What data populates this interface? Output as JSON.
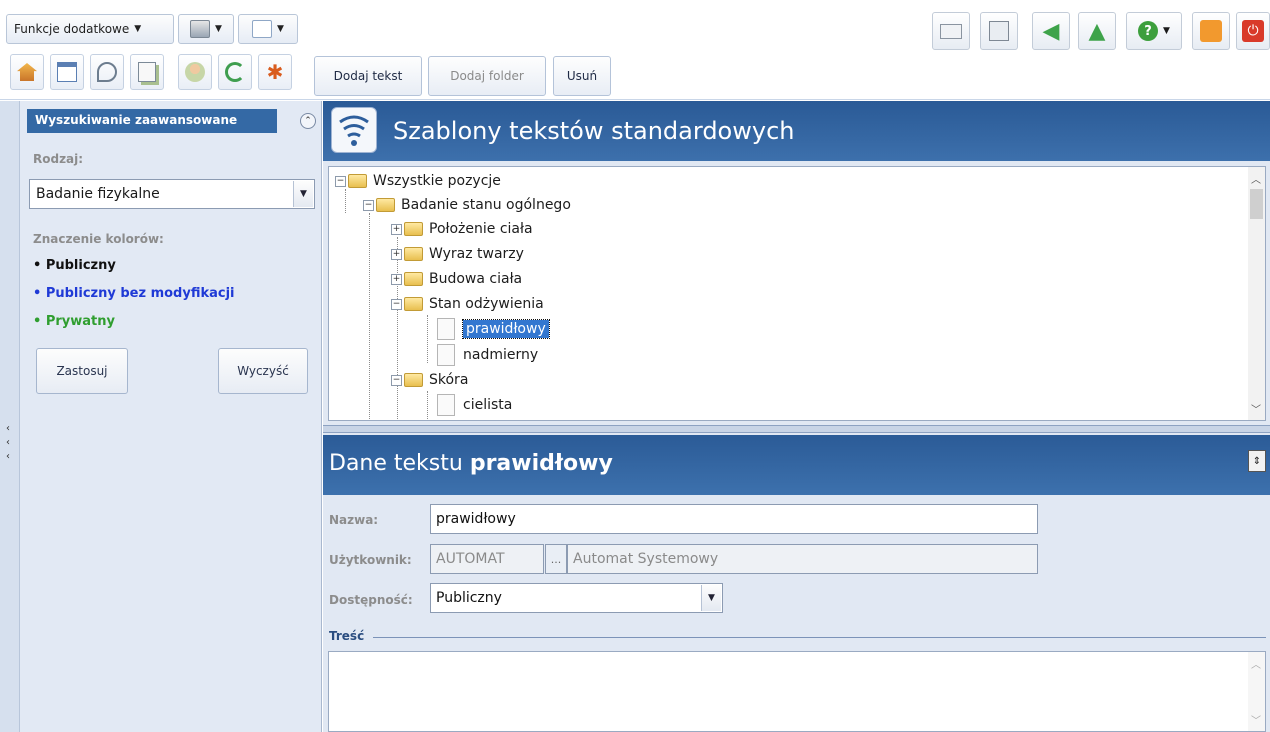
{
  "toolbar": {
    "func_dropdown": "Funkcje dodatkowe",
    "actions": {
      "add_text": "Dodaj tekst",
      "add_folder": "Dodaj folder",
      "delete": "Usuń"
    },
    "app_icons": [
      "home-icon",
      "calendar-icon",
      "stethoscope-icon",
      "documents-icon",
      "patients-icon",
      "refresh-icon",
      "gear-icon"
    ],
    "right_icons": [
      "mail-icon",
      "network-icon",
      "back-arrow-icon",
      "up-arrow-icon",
      "help-icon",
      "lock-icon",
      "power-icon"
    ]
  },
  "left_panel": {
    "header": "Wyszukiwanie zaawansowane",
    "rodzaj_label": "Rodzaj:",
    "rodzaj_value": "Badanie fizykalne",
    "colors_label": "Znaczenie kolorów:",
    "legend": [
      {
        "label": "• Publiczny",
        "color": "#111111"
      },
      {
        "label": "• Publiczny bez modyfikacji",
        "color": "#1f3ad6"
      },
      {
        "label": "• Prywatny",
        "color": "#2f9e2f"
      }
    ],
    "apply_button": "Zastosuj",
    "clear_button": "Wyczyść"
  },
  "main": {
    "title": "Szablony tekstów standardowych",
    "tree": {
      "root": "Wszystkie pozycje",
      "group": "Badanie stanu ogólnego",
      "items": [
        "Położenie ciała",
        "Wyraz twarzy",
        "Budowa ciała"
      ],
      "expanded": "Stan odżywienia",
      "expanded_children": [
        "prawidłowy",
        "nadmierny"
      ],
      "skin": "Skóra",
      "skin_children": [
        "cielista"
      ]
    }
  },
  "detail": {
    "title_prefix": "Dane tekstu",
    "title_name": "prawidłowy",
    "nazwa_label": "Nazwa:",
    "nazwa_value": "prawidłowy",
    "user_label": "Użytkownik:",
    "user_code": "AUTOMAT",
    "user_ellipsis": "...",
    "user_name": "Automat Systemowy",
    "dost_label": "Dostępność:",
    "dost_value": "Publiczny",
    "tresc_label": "Treść"
  }
}
